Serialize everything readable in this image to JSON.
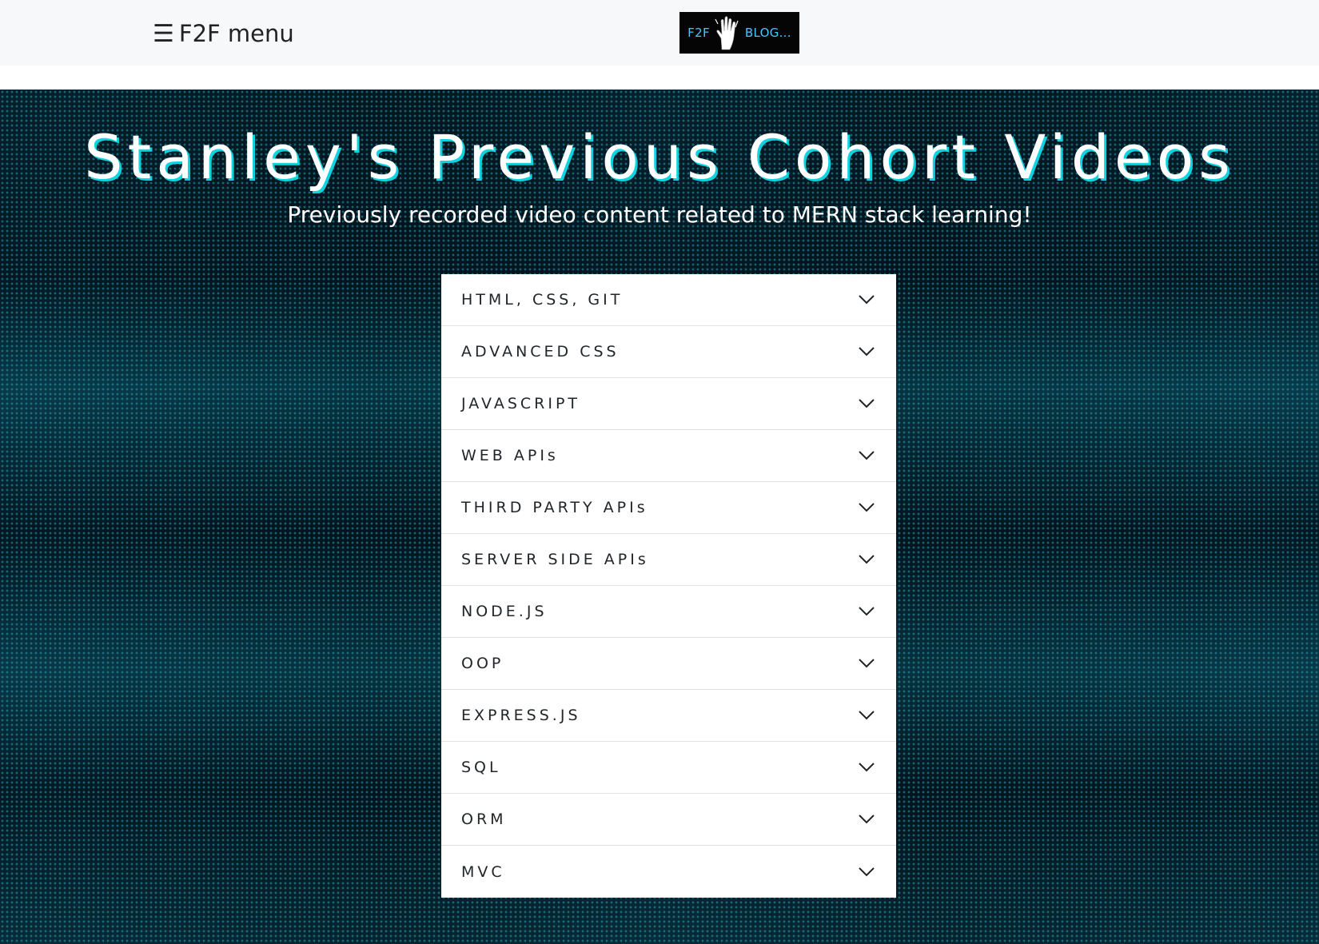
{
  "navbar": {
    "menu_icon": "hamburger-icon",
    "menu_label": "F2F menu",
    "logo": {
      "left_text": "F2F",
      "right_text": "BLOG...",
      "icon": "hand-icon",
      "text_color": "#48c6ff",
      "background": "#050505"
    }
  },
  "hero": {
    "title": "Stanley's Previous Cohort Videos",
    "subtitle": "Previously recorded video content related to MERN stack learning!",
    "title_shadow_color": "#0ed4e2"
  },
  "accordion": {
    "expand_icon": "chevron-down-icon",
    "items": [
      {
        "label": "HTML, CSS, GIT"
      },
      {
        "label": "ADVANCED CSS"
      },
      {
        "label": "JAVASCRIPT"
      },
      {
        "label": "WEB APIs"
      },
      {
        "label": "THIRD PARTY APIs"
      },
      {
        "label": "SERVER SIDE APIs"
      },
      {
        "label": "NODE.JS"
      },
      {
        "label": "OOP"
      },
      {
        "label": "EXPRESS.JS"
      },
      {
        "label": "SQL"
      },
      {
        "label": "ORM"
      },
      {
        "label": "MVC"
      }
    ]
  }
}
